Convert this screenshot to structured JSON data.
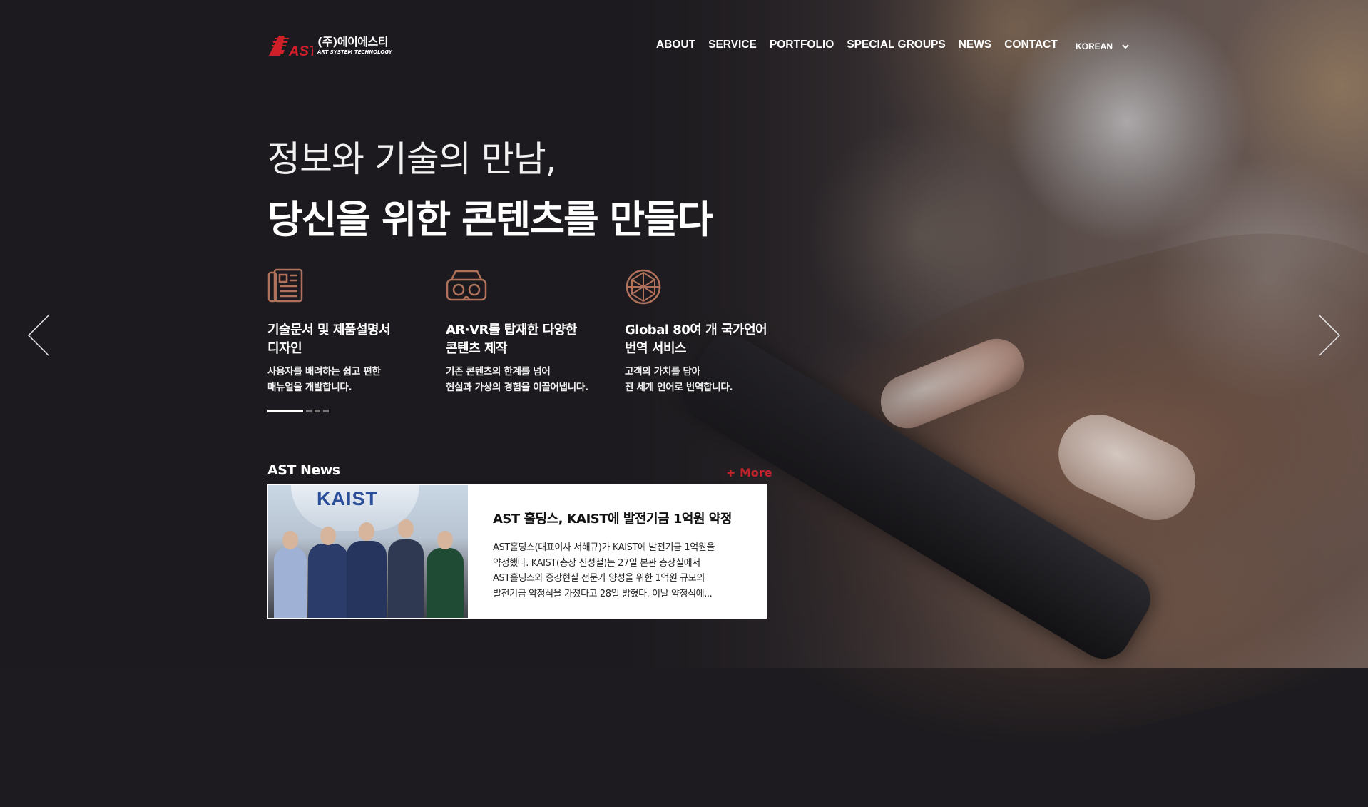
{
  "header": {
    "logo": {
      "mark": "AST",
      "company_ko": "(주)에이에스티",
      "company_en": "ART SYSTEM TECHNOLOGY"
    },
    "nav": [
      "ABOUT",
      "SERVICE",
      "PORTFOLIO",
      "SPECIAL GROUPS",
      "NEWS",
      "CONTACT"
    ],
    "language": "KOREAN"
  },
  "hero": {
    "line1": "정보와 기술의 만남,",
    "line2": "당신을 위한 콘텐츠를 만들다",
    "features": [
      {
        "icon": "document-icon",
        "title": "기술문서 및 제품설명서\n디자인",
        "desc": "사용자를 배려하는 쉽고 편한\n매뉴얼을 개발합니다."
      },
      {
        "icon": "vr-headset-icon",
        "title": "AR·VR를 탑재한 다양한\n콘텐츠 제작",
        "desc": "기존 콘텐츠의 한계를 넘어\n현실과 가상의 경험을 이끌어냅니다."
      },
      {
        "icon": "globe-network-icon",
        "title": "Global 80여 개 국가언어\n번역 서비스",
        "desc": "고객의 가치를 담아\n전 세계 언어로 번역합니다."
      }
    ],
    "slides_total": 4,
    "slide_current": 1
  },
  "news": {
    "section_title": "AST News",
    "more_label": "+ More",
    "item": {
      "image_text": "KAIST",
      "headline": "AST 홀딩스, KAIST에 발전기금 1억원 약정",
      "body": "AST홀딩스(대표이사 서해규)가 KAIST에 발전기금 1억원을\n약정했다. KAIST(총장 신성철)는 27일 본관 총장실에서\nAST홀딩스와 증강현실 전문가 양성을 위한 1억원 규모의\n발전기금 약정식을 가졌다고 28일 밝혔다. 이날 약정식에..."
    }
  },
  "colors": {
    "accent": "#c0242b",
    "icon": "#b0725a",
    "background": "#1d1b1f"
  }
}
